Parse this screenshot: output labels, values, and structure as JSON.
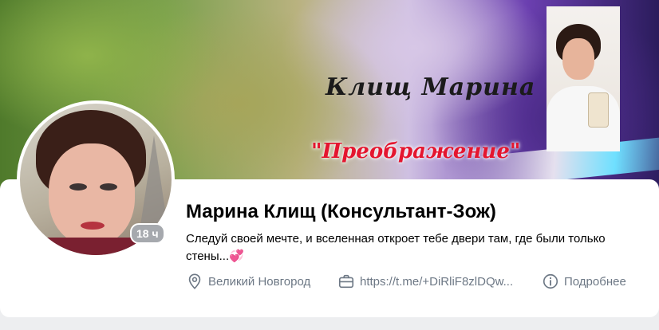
{
  "cover": {
    "name_text": "Клищ Марина",
    "slogan_text": "\"Преображение\""
  },
  "profile": {
    "name": "Марина Клищ (Консультант-Зож)",
    "status": "Следуй своей мечте, и вселенная откроет тебе двери там, где были только стены...💞",
    "last_seen_badge": "18 ч"
  },
  "info": {
    "location": "Великий Новгород",
    "link": "https://t.me/+DiRliF8zlDQw...",
    "more": "Подробнее",
    "location_icon": "location-pin-icon",
    "link_icon": "briefcase-icon",
    "more_icon": "info-circle-icon"
  },
  "colors": {
    "background": "#edeef0",
    "card": "#ffffff",
    "secondary_text": "#6d7885",
    "badge": "#a6a9ae"
  }
}
